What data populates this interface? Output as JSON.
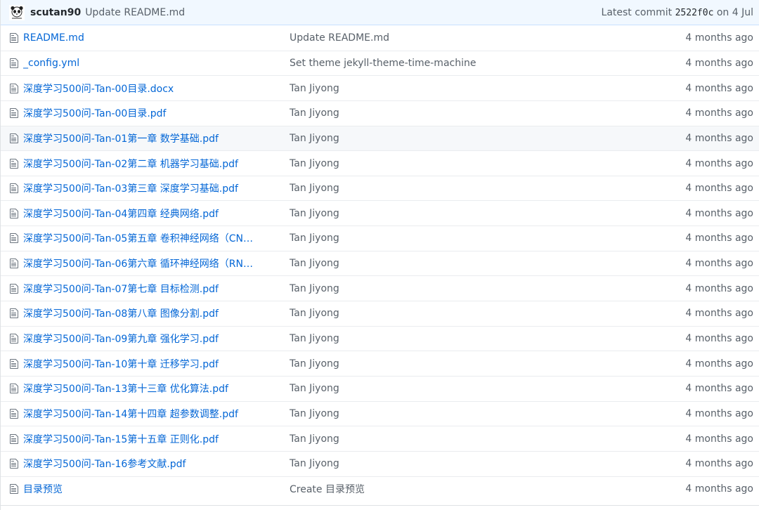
{
  "commit": {
    "author": "scutan90",
    "message": "Update README.md",
    "latest_label": "Latest commit",
    "sha": "2522f0c",
    "date": "on 4 Jul"
  },
  "files": [
    {
      "name": "README.md",
      "message": "Update README.md",
      "age": "4 months ago"
    },
    {
      "name": "_config.yml",
      "message": "Set theme jekyll-theme-time-machine",
      "age": "4 months ago"
    },
    {
      "name": "深度学习500问-Tan-00目录.docx",
      "message": "Tan Jiyong",
      "age": "4 months ago"
    },
    {
      "name": "深度学习500问-Tan-00目录.pdf",
      "message": "Tan Jiyong",
      "age": "4 months ago"
    },
    {
      "name": "深度学习500问-Tan-01第一章 数学基础.pdf",
      "message": "Tan Jiyong",
      "age": "4 months ago"
    },
    {
      "name": "深度学习500问-Tan-02第二章 机器学习基础.pdf",
      "message": "Tan Jiyong",
      "age": "4 months ago"
    },
    {
      "name": "深度学习500问-Tan-03第三章 深度学习基础.pdf",
      "message": "Tan Jiyong",
      "age": "4 months ago"
    },
    {
      "name": "深度学习500问-Tan-04第四章 经典网络.pdf",
      "message": "Tan Jiyong",
      "age": "4 months ago"
    },
    {
      "name": "深度学习500问-Tan-05第五章 卷积神经网络（CN…",
      "message": "Tan Jiyong",
      "age": "4 months ago"
    },
    {
      "name": "深度学习500问-Tan-06第六章 循环神经网络（RN…",
      "message": "Tan Jiyong",
      "age": "4 months ago"
    },
    {
      "name": "深度学习500问-Tan-07第七章 目标检测.pdf",
      "message": "Tan Jiyong",
      "age": "4 months ago"
    },
    {
      "name": "深度学习500问-Tan-08第八章 图像分割.pdf",
      "message": "Tan Jiyong",
      "age": "4 months ago"
    },
    {
      "name": "深度学习500问-Tan-09第九章 强化学习.pdf",
      "message": "Tan Jiyong",
      "age": "4 months ago"
    },
    {
      "name": "深度学习500问-Tan-10第十章 迁移学习.pdf",
      "message": "Tan Jiyong",
      "age": "4 months ago"
    },
    {
      "name": "深度学习500问-Tan-13第十三章 优化算法.pdf",
      "message": "Tan Jiyong",
      "age": "4 months ago"
    },
    {
      "name": "深度学习500问-Tan-14第十四章 超参数调整.pdf",
      "message": "Tan Jiyong",
      "age": "4 months ago"
    },
    {
      "name": "深度学习500问-Tan-15第十五章 正则化.pdf",
      "message": "Tan Jiyong",
      "age": "4 months ago"
    },
    {
      "name": "深度学习500问-Tan-16参考文献.pdf",
      "message": "Tan Jiyong",
      "age": "4 months ago"
    },
    {
      "name": "目录预览",
      "message": "Create 目录预览",
      "age": "4 months ago"
    }
  ],
  "icons": {
    "avatar": "panda-avatar-icon",
    "file": "file-icon"
  }
}
